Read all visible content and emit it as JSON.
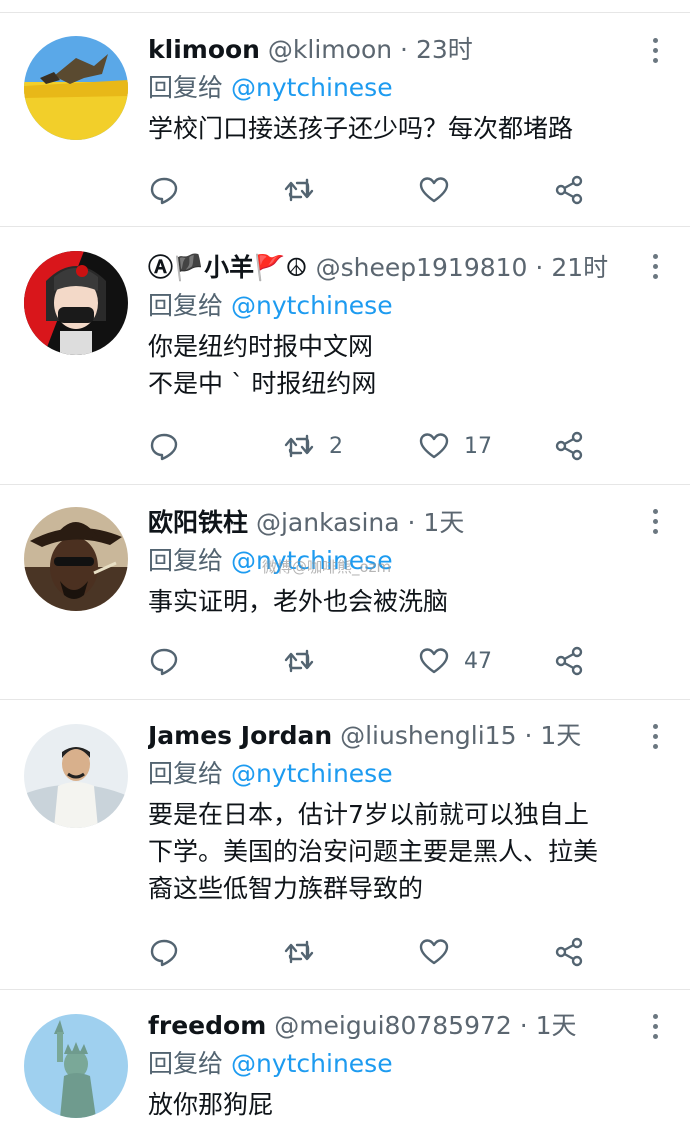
{
  "colors": {
    "accent": "#1d9bf0",
    "text": "#0f1419",
    "muted": "#536471"
  },
  "watermark": "微博@咖啡熊_ozm",
  "tweets": [
    {
      "name": "klimoon",
      "handle": "@klimoon",
      "sep": " · ",
      "time": "23时",
      "reply_prefix": "回复给",
      "reply_to": "@nytchinese",
      "text": "学校门口接送孩子还少吗？每次都堵路",
      "retweets": "",
      "likes": "",
      "avatar_icon": "wheat-field-avatar"
    },
    {
      "name": "Ⓐ🏴小羊🚩☮",
      "handle": "@sheep1919810",
      "sep": " · ",
      "time": "21时",
      "reply_prefix": "回复给",
      "reply_to": "@nytchinese",
      "text": "你是纽约时报中文网\n不是中 ˋ 时报纽约网",
      "retweets": "2",
      "likes": "17",
      "avatar_icon": "masked-girl-avatar"
    },
    {
      "name": "欧阳铁柱",
      "handle": "@jankasina",
      "sep": " · ",
      "time": "1天",
      "reply_prefix": "回复给",
      "reply_to": "@nytchinese",
      "text": "事实证明，老外也会被洗脑",
      "retweets": "",
      "likes": "47",
      "avatar_icon": "cowboy-avatar"
    },
    {
      "name": "James Jordan",
      "handle": "@liushengli15",
      "sep": " · ",
      "time": "1天",
      "reply_prefix": "回复给",
      "reply_to": "@nytchinese",
      "text": "要是在日本，估计7岁以前就可以独自上\n下学。美国的治安问题主要是黑人、拉美\n裔这些低智力族群导致的",
      "retweets": "",
      "likes": "",
      "avatar_icon": "portrait-avatar"
    },
    {
      "name": "freedom",
      "handle": "@meigui80785972",
      "sep": " · ",
      "time": "1天",
      "reply_prefix": "回复给",
      "reply_to": "@nytchinese",
      "text": "放你那狗屁",
      "retweets": "",
      "likes": "",
      "avatar_icon": "statue-of-liberty-avatar"
    }
  ]
}
